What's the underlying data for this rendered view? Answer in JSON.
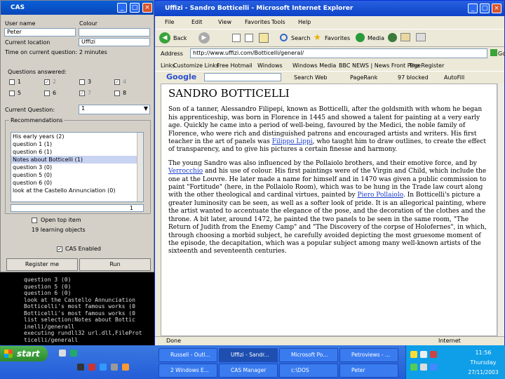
{
  "cas": {
    "title": "CAS",
    "user_name_label": "User name",
    "colour_label": "Colour",
    "user_name_value": "Peter",
    "current_location_label": "Current location",
    "current_location_value": "Uffizi",
    "time_on_question": "Time on current question: 2 minutes",
    "questions_answered_label": "Questions answered:",
    "questions": [
      {
        "label": "1",
        "checked": false
      },
      {
        "label": "2",
        "checked": true
      },
      {
        "label": "3",
        "checked": false
      },
      {
        "label": "4",
        "checked": true
      },
      {
        "label": "5",
        "checked": false
      },
      {
        "label": "6",
        "checked": false
      },
      {
        "label": "7",
        "checked": true
      },
      {
        "label": "8",
        "checked": false
      }
    ],
    "current_question_label": "Current Question:",
    "current_question_value": "1",
    "recommendations_label": "Recommendations",
    "recommendations": [
      "His early years (2)",
      "question 1 (1)",
      "question 6 (1)",
      "Notes about Botticelli (1)",
      "question 3 (0)",
      "question 5 (0)",
      "question 6 (0)",
      "look at the Castello Annunciation (0)"
    ],
    "selected_index": 3,
    "spinner_value": "1",
    "open_top_item_label": "Open top item",
    "learning_objects_count": "19 learning objects",
    "cas_enabled_label": "CAS Enabled",
    "register_button": "Register me",
    "run_button": "Run"
  },
  "console": {
    "lines": [
      "question 3 (0)",
      "question 5 (0)",
      "question 6 (0)",
      "look at the Castello Annunciation",
      "Botticelli's most famous works (0",
      "Botticelli's most famous works (0",
      "list selection:Notes about Bottic",
      "inelli/generall",
      "executing rundll32 url.dll,FileProt",
      "ticelli/generall"
    ]
  },
  "ie": {
    "title": "Uffizi - Sandro Botticelli - Microsoft Internet Explorer",
    "menu": [
      "File",
      "Edit",
      "View",
      "Favorites",
      "Tools",
      "Help"
    ],
    "toolbar": [
      "Back",
      "Search",
      "Favorites",
      "Media"
    ],
    "address_label": "Address",
    "address_value": "http://www.uffizi.com/Botticelli/general/",
    "go_label": "Go",
    "links_label": "Links",
    "links": [
      "Customize Links",
      "Free Hotmail",
      "Windows",
      "Windows Media",
      "BBC NEWS | News Front Page",
      "The Register"
    ],
    "google_label": "Google",
    "google_search": "Search Web",
    "pagerank": "PageRank",
    "popups": "97 blocked",
    "autofill": "AutoFill",
    "status_left": "Done",
    "status_right": "Internet",
    "page": {
      "heading": "SANDRO BOTTICELLI",
      "p1_a": "Son of a tanner, Alessandro Filipepi, known as Botticelli, after the goldsmith with whom he began his apprenticeship, was born in Florence in 1445 and showed a talent for painting at a very early age. Quickly he came into a period of well-being, favoured by the Medici, the noble family of Florence, who were rich and distinguished patrons and encouraged artists and writers. His first teacher in the art of panels was ",
      "p1_link": "Filippo Lippi",
      "p1_b": ", who taught him to draw outlines, to create the effect of transparency, and to give his pictures a certain finesse and harmony.",
      "p2_a": "The young Sandro was also influenced by the Pollaiolo brothers, and their emotive force, and by ",
      "p2_link1": "Verrocchio",
      "p2_b": " and his use of colour. His first paintings were of the Virgin and Child, which include the one at the Louvre. He later made a name for himself and in 1470 was given a public commission to paint \"Fortitude\" (here, in the Pollaiolo Room), which was to be hung in the Trade law court along with the other theological and cardinal virtues, painted by ",
      "p2_link2": "Piero Pollaiolo",
      "p2_c": ". In Botticelli's picture a greater luminosity can be seen, as well as a softer look of pride. It is an allegorical painting, where the artist wanted to accentuate the elegance of the pose, and the decoration of the clothes and the throne. A bit later, around 1472, he painted the two panels to be seen in the same room, \"The Return of Judith from the Enemy Camp\" and \"The Discovery of the corpse of Holofernes\", in which, through choosing a morbid subject, he carefully avoided depicting the most gruesome moment of the episode, the decapitation, which was a popular subject among many well-known artists of the sixteenth and seventeenth centuries."
    }
  },
  "taskbar": {
    "start": "start",
    "tasks_row1": [
      "Russell - Outl...",
      "Uffizi - Sandr...",
      "Microsoft Po...",
      "Petroviews - ..."
    ],
    "tasks_row2": [
      "2 Windows E...",
      "CAS Manager",
      "c:\\DOS",
      "Peter"
    ],
    "active_task": 1,
    "clock_time": "11:56",
    "clock_day": "Thursday",
    "clock_date": "27/11/2003"
  }
}
